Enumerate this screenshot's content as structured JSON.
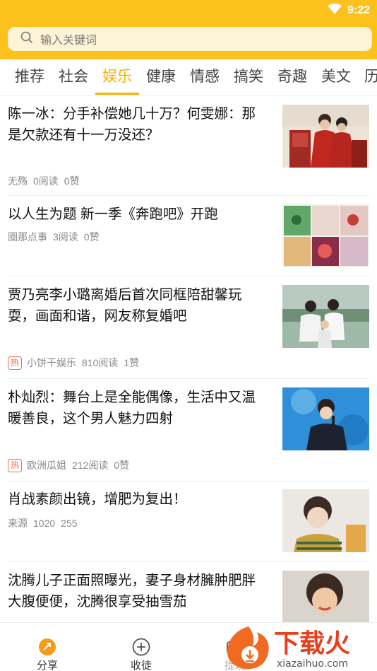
{
  "status": {
    "time": "9:22"
  },
  "search": {
    "placeholder": "输入关键词"
  },
  "tabs": [
    {
      "label": "推荐"
    },
    {
      "label": "社会"
    },
    {
      "label": "娱乐",
      "active": true
    },
    {
      "label": "健康"
    },
    {
      "label": "情感"
    },
    {
      "label": "搞笑"
    },
    {
      "label": "奇趣"
    },
    {
      "label": "美文"
    },
    {
      "label": "历"
    }
  ],
  "articles": [
    {
      "title": "陈一冰：分手补偿她几十万？何雯娜：那是欠款还有十一万没还？",
      "source": "无殇",
      "reads": "0阅读",
      "likes": "0赞",
      "hot": false
    },
    {
      "title": "以人生为题 新一季《奔跑吧》开跑",
      "source": "圈那点事",
      "reads": "3阅读",
      "likes": "0赞",
      "hot": false
    },
    {
      "title": "贾乃亮李小璐离婚后首次同框陪甜馨玩耍，画面和谐，网友称复婚吧",
      "source": "小饼干娱乐",
      "reads": "810阅读",
      "likes": "1赞",
      "hot": true,
      "hot_label": "热"
    },
    {
      "title": "朴灿烈：舞台上是全能偶像，生活中又温暖善良，这个男人魅力四射",
      "source": "欧洲瓜姐",
      "reads": "212阅读",
      "likes": "0赞",
      "hot": true,
      "hot_label": "热"
    },
    {
      "title": "肖战素颜出镜，增肥为复出！",
      "source": "来源",
      "reads": "1020",
      "likes": "255",
      "hot": false
    },
    {
      "title": "沈腾儿子正面照曝光，妻子身材臃肿肥胖大腹便便，沈腾很享受抽雪茄",
      "source": "",
      "reads": "",
      "likes": "",
      "hot": false
    }
  ],
  "bottom_nav": [
    {
      "label": "分享",
      "icon": "share-orb-icon"
    },
    {
      "label": "收徒",
      "icon": "plus-circle-icon"
    },
    {
      "label": "提现",
      "icon": "wallet-icon"
    }
  ],
  "watermark": {
    "text": "下载火",
    "url": "xiazaihuo.com"
  },
  "colors": {
    "brand": "#fcc11c",
    "accent": "#f4b200",
    "hot": "#f0704a"
  }
}
